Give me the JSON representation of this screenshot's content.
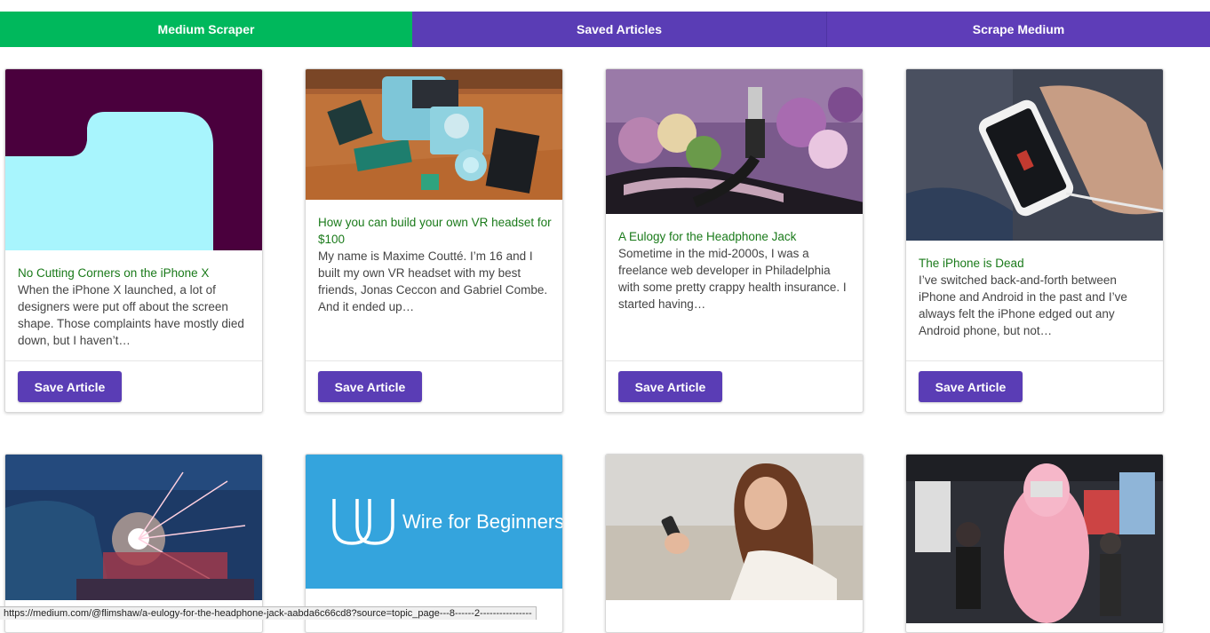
{
  "nav": {
    "brand": "Medium Scraper",
    "saved": "Saved Articles",
    "scrape": "Scrape Medium"
  },
  "save_label": "Save Article",
  "articles": [
    {
      "title": "No Cutting Corners on the iPhone X",
      "desc": "When the iPhone X launched, a lot of designers were put off about the screen shape. Those complaints have mostly died down, but I haven’t…"
    },
    {
      "title": "How you can build your own VR headset for $100",
      "desc": "My name is Maxime Coutté. I’m 16 and I built my own VR headset with my best friends, Jonas Ceccon and Gabriel Combe. And it ended up…"
    },
    {
      "title": "A Eulogy for the Headphone Jack",
      "desc": "Sometime in the mid-2000s, I was a freelance web developer in Philadelphia with some pretty crappy health insurance. I started having…"
    },
    {
      "title": "The iPhone is Dead",
      "desc": "I’ve switched back-and-forth between iPhone and Android in the past and I’ve always felt the iPhone edged out any Android phone, but not…"
    }
  ],
  "row2_image_text": "Wire for Beginners",
  "status_url": "https://medium.com/@flimshaw/a-eulogy-for-the-headphone-jack-aabda6c66cd8?source=topic_page---8------2----------------"
}
